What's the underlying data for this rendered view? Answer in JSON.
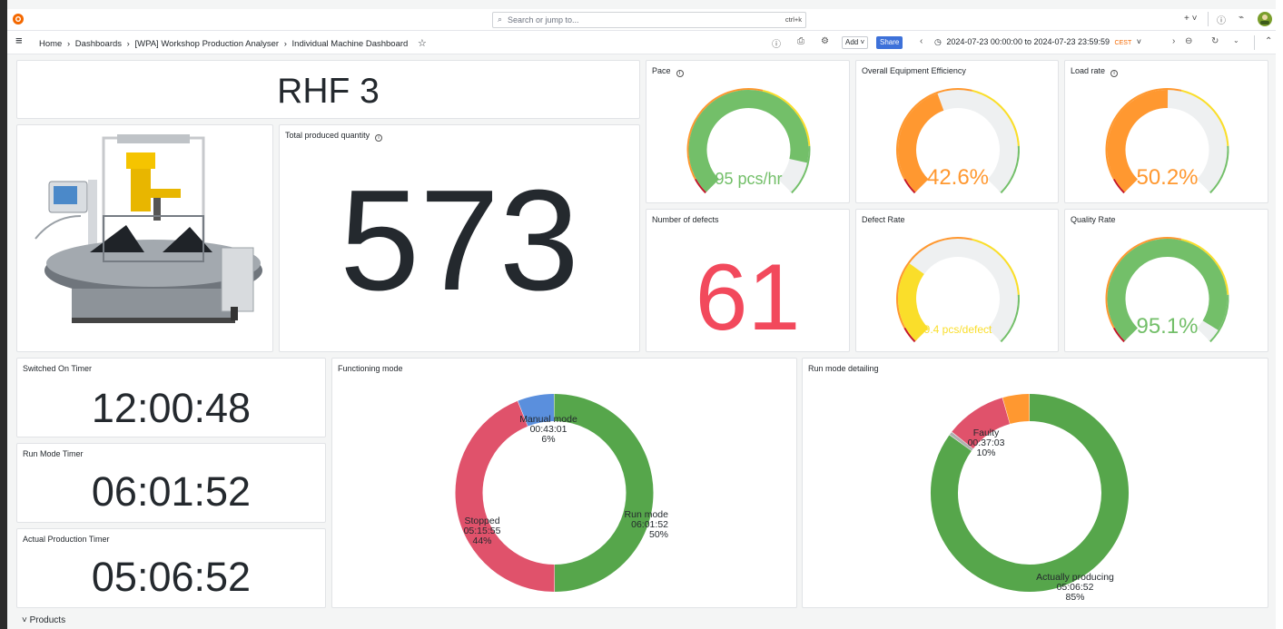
{
  "topbar": {
    "search_placeholder": "Search or jump to...",
    "search_shortcut": "ctrl+k",
    "plus_label": "+ ˅"
  },
  "breadcrumb": {
    "home": "Home",
    "sep": "›",
    "dashboards": "Dashboards",
    "folder": "[WPA] Workshop Production Analyser",
    "current": "Individual Machine Dashboard"
  },
  "toolbar": {
    "add_label": "Add ˅",
    "share_label": "Share",
    "time_range": "2024-07-23 00:00:00 to 2024-07-23 23:59:59",
    "timezone": "CEST",
    "timezone_caret": "˅"
  },
  "panels": {
    "machine_name": "RHF 3",
    "total_quantity": {
      "title": "Total produced quantity",
      "value": "573"
    },
    "pace": {
      "title": "Pace",
      "value": "95 pcs/hr",
      "fraction": 0.88,
      "color": "#73bf69"
    },
    "oee": {
      "title": "Overall Equipment Efficiency",
      "value": "42.6%",
      "fraction": 0.426,
      "color": "#ff9830"
    },
    "load_rate": {
      "title": "Load rate",
      "value": "50.2%",
      "fraction": 0.502,
      "color": "#ff9830"
    },
    "defects": {
      "title": "Number of defects",
      "value": "61",
      "color": "#f2495c"
    },
    "defect_rate": {
      "title": "Defect Rate",
      "value": "9.4 pcs/defect",
      "fraction": 0.3,
      "color": "#fade2a"
    },
    "quality_rate": {
      "title": "Quality Rate",
      "value": "95.1%",
      "fraction": 0.951,
      "color": "#73bf69"
    },
    "switched_on": {
      "title": "Switched On Timer",
      "value": "12:00:48"
    },
    "run_mode": {
      "title": "Run Mode Timer",
      "value": "06:01:52"
    },
    "actual_production": {
      "title": "Actual Production Timer",
      "value": "05:06:52"
    },
    "functioning_mode": {
      "title": "Functioning mode",
      "slices": [
        {
          "name": "Run mode",
          "time": "06:01:52",
          "pct": "50%",
          "value": 50,
          "color": "#56a64b"
        },
        {
          "name": "Stopped",
          "time": "05:15:55",
          "pct": "44%",
          "value": 44,
          "color": "#e0526b"
        },
        {
          "name": "Manual mode",
          "time": "00:43:01",
          "pct": "6%",
          "value": 6,
          "color": "#5a8fdd"
        }
      ]
    },
    "run_mode_detail": {
      "title": "Run mode detailing",
      "slices": [
        {
          "name": "Actually producing",
          "time": "05:06:52",
          "pct": "85%",
          "value": 85,
          "color": "#56a64b"
        },
        {
          "name": "",
          "time": "",
          "pct": "",
          "value": 0.6,
          "color": "#b0b0b0"
        },
        {
          "name": "Faulty",
          "time": "00:37:03",
          "pct": "10%",
          "value": 10,
          "color": "#e0526b"
        },
        {
          "name": "",
          "time": "",
          "pct": "",
          "value": 4.4,
          "color": "#ff9830"
        }
      ]
    }
  },
  "footer": {
    "products_row": "˅ Products"
  }
}
